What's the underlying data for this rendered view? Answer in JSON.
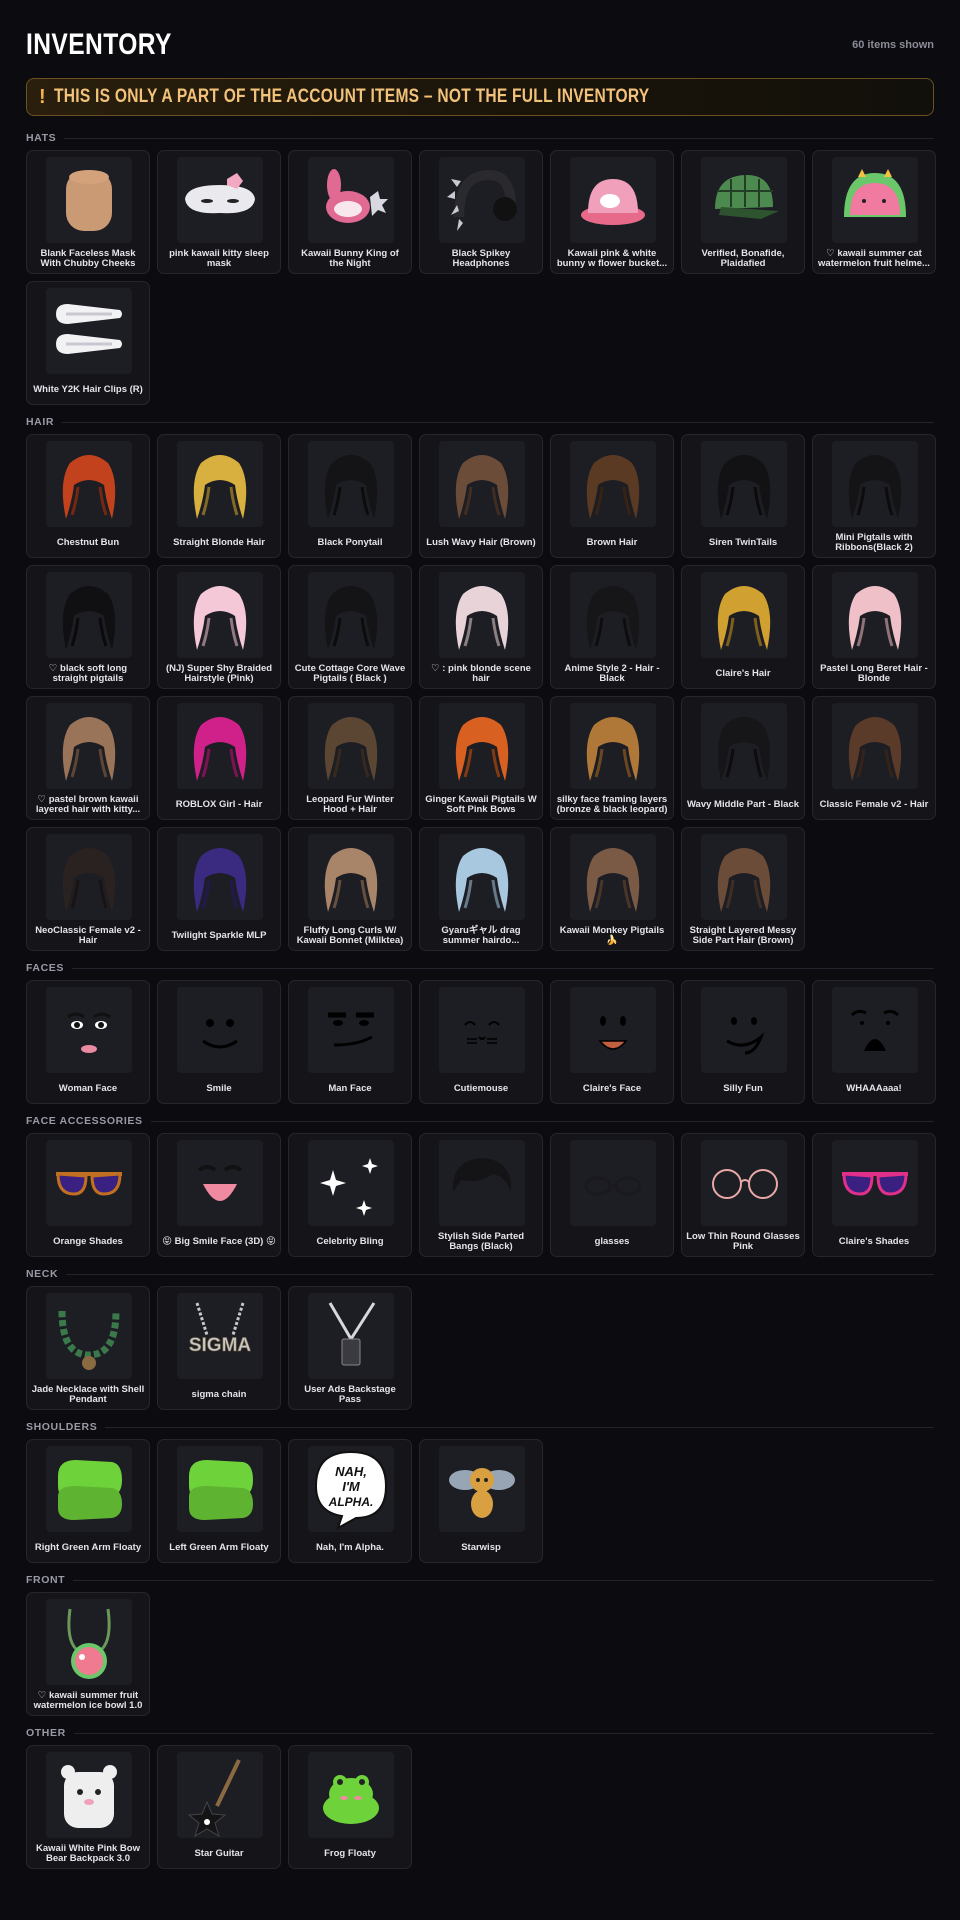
{
  "header": {
    "title": "INVENTORY",
    "count": "60 items shown"
  },
  "banner": {
    "icon": "!",
    "text": "THIS IS ONLY A PART OF THE ACCOUNT ITEMS – NOT THE FULL INVENTORY"
  },
  "sections": [
    {
      "title": "HATS",
      "items": [
        {
          "name": "Blank Faceless Mask With Chubby Cheeks",
          "icon": "mask-icon",
          "color": "#c99a74"
        },
        {
          "name": "pink kawaii kitty sleep mask",
          "icon": "sleep-mask-icon",
          "color": "#e9e9ee"
        },
        {
          "name": "Kawaii Bunny King of the Night",
          "icon": "bunny-hat-icon",
          "color": "#e06a92"
        },
        {
          "name": "Black Spikey Headphones",
          "icon": "headphones-icon",
          "color": "#2a2a2e"
        },
        {
          "name": "Kawaii pink & white bunny w flower bucket...",
          "icon": "bucket-hat-icon",
          "color": "#f0a0bb"
        },
        {
          "name": "Verified, Bonafide, Plaidafied",
          "icon": "plaid-cap-icon",
          "color": "#4d8a4f"
        },
        {
          "name": "♡ kawaii summer cat watermelon fruit helme...",
          "icon": "watermelon-helmet-icon",
          "color": "#f07aa0"
        },
        {
          "name": "White Y2K Hair Clips (R)",
          "icon": "hair-clips-icon",
          "color": "#f2f2f4"
        }
      ]
    },
    {
      "title": "HAIR",
      "items": [
        {
          "name": "Chestnut Bun",
          "icon": "hair-icon",
          "color": "#c2421e"
        },
        {
          "name": "Straight Blonde Hair",
          "icon": "hair-icon",
          "color": "#d8b040"
        },
        {
          "name": "Black Ponytail",
          "icon": "hair-icon",
          "color": "#141416"
        },
        {
          "name": "Lush Wavy Hair (Brown)",
          "icon": "hair-icon",
          "color": "#6b4c38"
        },
        {
          "name": "Brown Hair",
          "icon": "hair-icon",
          "color": "#5a3a22"
        },
        {
          "name": "Siren TwinTails",
          "icon": "hair-icon",
          "color": "#121214"
        },
        {
          "name": "Mini Pigtails with Ribbons(Black 2)",
          "icon": "hair-icon",
          "color": "#141416"
        },
        {
          "name": "♡ black soft long straight pigtails",
          "icon": "hair-icon",
          "color": "#101012"
        },
        {
          "name": "(NJ) Super Shy Braided Hairstyle (Pink)",
          "icon": "hair-icon",
          "color": "#f4c8d6"
        },
        {
          "name": "Cute Cottage Core Wave Pigtails ( Black )",
          "icon": "hair-icon",
          "color": "#141416"
        },
        {
          "name": "♡ : pink blonde scene hair",
          "icon": "hair-icon",
          "color": "#e8d4d8"
        },
        {
          "name": "Anime Style 2 - Hair - Black",
          "icon": "hair-icon",
          "color": "#161618"
        },
        {
          "name": "Claire's Hair",
          "icon": "hair-icon",
          "color": "#d0a030"
        },
        {
          "name": "Pastel Long Beret Hair - Blonde",
          "icon": "hair-icon",
          "color": "#f0c0c8"
        },
        {
          "name": "♡ pastel brown kawaii layered hair with kitty...",
          "icon": "hair-icon",
          "color": "#9a7458"
        },
        {
          "name": "ROBLOX Girl - Hair",
          "icon": "hair-icon",
          "color": "#d0208a"
        },
        {
          "name": "Leopard Fur Winter Hood + Hair",
          "icon": "hair-icon",
          "color": "#5a4632"
        },
        {
          "name": "Ginger Kawaii Pigtails W Soft Pink Bows",
          "icon": "hair-icon",
          "color": "#d86020"
        },
        {
          "name": "silky face framing layers (bronze & black leopard)",
          "icon": "hair-icon",
          "color": "#b07838"
        },
        {
          "name": "Wavy Middle Part - Black",
          "icon": "hair-icon",
          "color": "#161618"
        },
        {
          "name": "Classic Female v2 - Hair",
          "icon": "hair-icon",
          "color": "#5a3a28"
        },
        {
          "name": "NeoClassic Female v2 - Hair",
          "icon": "hair-icon",
          "color": "#2a2220"
        },
        {
          "name": "Twilight Sparkle MLP",
          "icon": "hair-icon",
          "color": "#3a2a80"
        },
        {
          "name": "Fluffy Long Curls W/ Kawaii Bonnet (Milktea)",
          "icon": "hair-icon",
          "color": "#a88468"
        },
        {
          "name": "Gyaruギャル drag summer hairdo...",
          "icon": "hair-icon",
          "color": "#a8c8e0"
        },
        {
          "name": "Kawaii Monkey Pigtails 🍌",
          "icon": "hair-icon",
          "color": "#7a5a44"
        },
        {
          "name": "Straight Layered Messy Side Part Hair (Brown)",
          "icon": "hair-icon",
          "color": "#6a4c38"
        }
      ]
    },
    {
      "title": "FACES",
      "items": [
        {
          "name": "Woman Face",
          "icon": "face-icon",
          "color": "#ffffff"
        },
        {
          "name": "Smile",
          "icon": "face-icon",
          "color": "#000000"
        },
        {
          "name": "Man Face",
          "icon": "face-icon",
          "color": "#000000"
        },
        {
          "name": "Cutiemouse",
          "icon": "face-icon",
          "color": "#000000"
        },
        {
          "name": "Claire's Face",
          "icon": "face-icon",
          "color": "#c06040"
        },
        {
          "name": "Silly Fun",
          "icon": "face-icon",
          "color": "#000000"
        },
        {
          "name": "WHAAAaaa!",
          "icon": "face-icon",
          "color": "#000000"
        }
      ]
    },
    {
      "title": "FACE ACCESSORIES",
      "items": [
        {
          "name": "Orange Shades",
          "icon": "sunglasses-icon",
          "color": "#c07020"
        },
        {
          "name": "😝 Big Smile Face (3D) 😝",
          "icon": "smile-face-icon",
          "color": "#f08aa0"
        },
        {
          "name": "Celebrity Bling",
          "icon": "sparkle-icon",
          "color": "#ffffff"
        },
        {
          "name": "Stylish Side Parted Bangs (Black)",
          "icon": "bangs-icon",
          "color": "#141416"
        },
        {
          "name": "glasses",
          "icon": "glasses-icon",
          "color": "#1a1a1e"
        },
        {
          "name": "Low Thin Round Glasses Pink",
          "icon": "round-glasses-icon",
          "color": "#e8a8a8"
        },
        {
          "name": "Claire's Shades",
          "icon": "sunglasses-icon",
          "color": "#e0308a"
        }
      ]
    },
    {
      "title": "NECK",
      "items": [
        {
          "name": "Jade Necklace with Shell Pendant",
          "icon": "necklace-icon",
          "color": "#3a7a4a"
        },
        {
          "name": "sigma chain",
          "icon": "chain-icon",
          "color": "#c8c8cc"
        },
        {
          "name": "User Ads Backstage Pass",
          "icon": "lanyard-icon",
          "color": "#d8d8dc"
        }
      ]
    },
    {
      "title": "SHOULDERS",
      "items": [
        {
          "name": "Right Green Arm Floaty",
          "icon": "arm-floaty-icon",
          "color": "#6ed23a"
        },
        {
          "name": "Left Green Arm Floaty",
          "icon": "arm-floaty-icon",
          "color": "#6ed23a"
        },
        {
          "name": "Nah, I'm Alpha.",
          "icon": "speech-bubble-icon",
          "color": "#ffffff",
          "bubble_text": "NAH, I'M ALPHA."
        },
        {
          "name": "Starwisp",
          "icon": "bee-icon",
          "color": "#d8a040"
        }
      ]
    },
    {
      "title": "FRONT",
      "items": [
        {
          "name": "♡ kawaii summer fruit watermelon ice bowl 1.0",
          "icon": "watermelon-bowl-icon",
          "color": "#f07a90"
        }
      ]
    },
    {
      "title": "OTHER",
      "items": [
        {
          "name": "Kawaii White Pink Bow Bear Backpack 3.0",
          "icon": "backpack-icon",
          "color": "#eeeeee"
        },
        {
          "name": "Star Guitar",
          "icon": "guitar-icon",
          "color": "#141416"
        },
        {
          "name": "Frog Floaty",
          "icon": "frog-icon",
          "color": "#6ed23a"
        }
      ]
    }
  ]
}
